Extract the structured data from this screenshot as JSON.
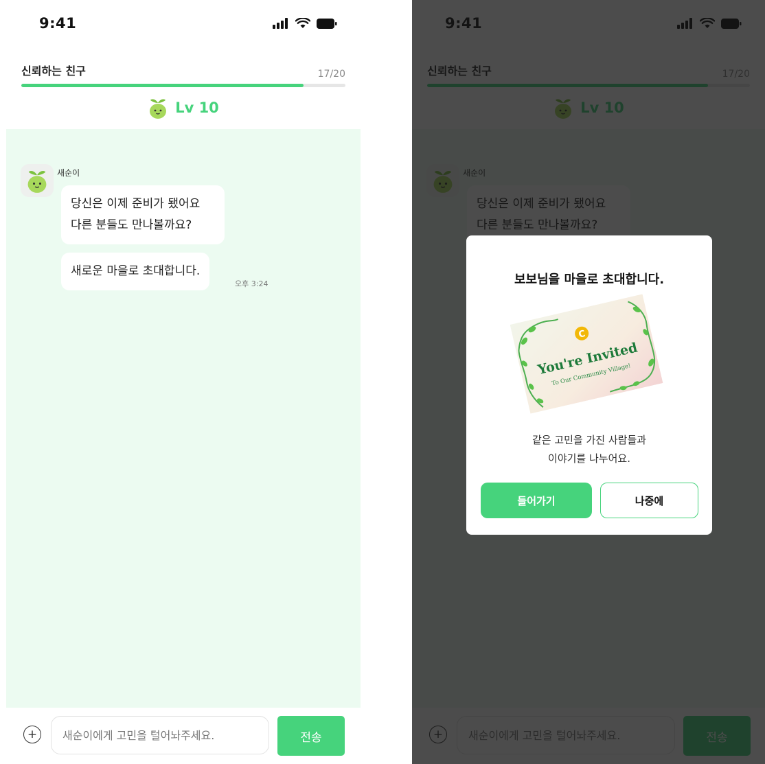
{
  "status_bar": {
    "time": "9:41"
  },
  "header": {
    "title": "신뢰하는 친구",
    "count": "17/20",
    "progress": 0.87,
    "level": "Lv 10"
  },
  "chat": {
    "sender": "새순이",
    "messages": [
      {
        "line1": "당신은 이제 준비가 됐어요",
        "line2": "다른 분들도 만나볼까요?"
      },
      {
        "line1": "새로운 마을로 초대합니다."
      }
    ],
    "timestamp": "오후 3:24"
  },
  "composer": {
    "placeholder": "새순이에게 고민을 털어놔주세요.",
    "send_label": "전송"
  },
  "modal": {
    "title": "보보님을 마을로 초대합니다.",
    "card": {
      "heading": "You're Invited",
      "subheading": "To Our Community Village!",
      "badge": "C"
    },
    "line1": "같은 고민을 가진 사람들과",
    "line2": "이야기를 나누어요.",
    "enter_label": "들어가기",
    "later_label": "나중에"
  },
  "colors": {
    "accent": "#46d37c",
    "chat_bg": "#ecfbf1"
  },
  "icons": [
    "signal-icon",
    "wifi-icon",
    "battery-icon",
    "sprout-icon",
    "plus-circle-icon"
  ]
}
